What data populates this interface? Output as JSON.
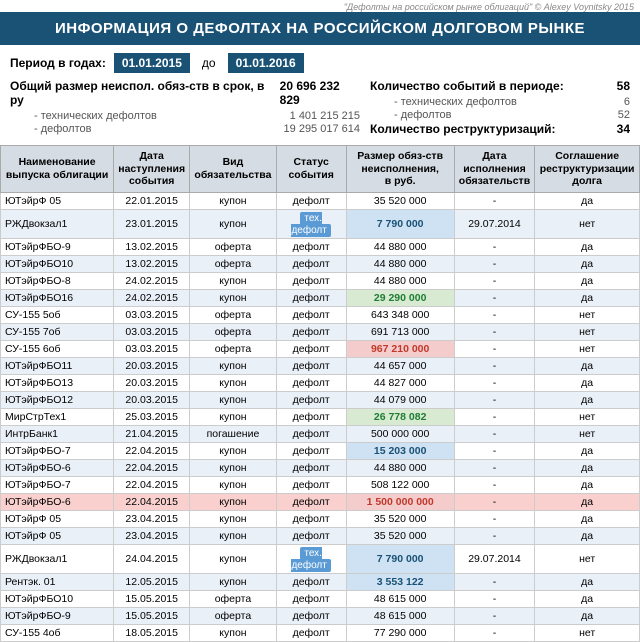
{
  "watermark": "\"Дефолты на российском рынке облигаций\" © Alexey Voynitsky 2015",
  "title": "ИНФОРМАЦИЯ О ДЕФОЛТАХ НА РОССИЙСКОМ ДОЛГОВОМ РЫНКЕ",
  "period": {
    "label": "Период в годах:",
    "from": "01.01.2015",
    "to_label": "до",
    "to": "01.01.2016"
  },
  "stats": {
    "left": {
      "main_label": "Общий размер неиспол. обяз-ств в срок, в ру",
      "main_value": "20 696 232 829",
      "sub1_label": "- технических дефолтов",
      "sub1_value": "1 401 215 215",
      "sub2_label": "- дефолтов",
      "sub2_value": "19 295 017 614"
    },
    "right": {
      "events_label": "Количество событий в периоде:",
      "events_value": "58",
      "tech_label": "- технических дефолтов",
      "tech_value": "6",
      "default_label": "- дефолтов",
      "default_value": "52",
      "restr_label": "Количество реструктуризаций:",
      "restr_value": "34"
    }
  },
  "table": {
    "headers": [
      "Наименование\nвыпуска облигации",
      "Дата\nнаступления\nсобытия",
      "Вид\nобязательства",
      "Статус\nсобытия",
      "Размер обяз-ств\nнеисполнения,\nв руб.",
      "Дата\nисполнения\nобязательств",
      "Соглашение\nреструктуризации\nдолга"
    ],
    "rows": [
      {
        "name": "ЮТэйрФ 05",
        "date": "22.01.2015",
        "type": "купон",
        "status": "дефолт",
        "amount": "35 520 000",
        "exec_date": "-",
        "agree": "да",
        "amount_class": ""
      },
      {
        "name": "РЖДвокзал1",
        "date": "23.01.2015",
        "type": "купон",
        "status": "тех. дефолт",
        "amount": "7 790 000",
        "exec_date": "29.07.2014",
        "agree": "нет",
        "amount_class": "blue"
      },
      {
        "name": "ЮТэйрФБО-9",
        "date": "13.02.2015",
        "type": "оферта",
        "status": "дефолт",
        "amount": "44 880 000",
        "exec_date": "-",
        "agree": "да",
        "amount_class": ""
      },
      {
        "name": "ЮТэйрФБО10",
        "date": "13.02.2015",
        "type": "оферта",
        "status": "дефолт",
        "amount": "44 880 000",
        "exec_date": "-",
        "agree": "да",
        "amount_class": ""
      },
      {
        "name": "ЮТэйрФБО-8",
        "date": "24.02.2015",
        "type": "купон",
        "status": "дефолт",
        "amount": "44 880 000",
        "exec_date": "-",
        "agree": "да",
        "amount_class": ""
      },
      {
        "name": "ЮТэйрФБО16",
        "date": "24.02.2015",
        "type": "купон",
        "status": "дефолт",
        "amount": "29 290 000",
        "exec_date": "-",
        "agree": "да",
        "amount_class": "green"
      },
      {
        "name": "СУ-155 5об",
        "date": "03.03.2015",
        "type": "оферта",
        "status": "дефолт",
        "amount": "643 348 000",
        "exec_date": "-",
        "agree": "нет",
        "amount_class": ""
      },
      {
        "name": "СУ-155 7об",
        "date": "03.03.2015",
        "type": "оферта",
        "status": "дефолт",
        "amount": "691 713 000",
        "exec_date": "-",
        "agree": "нет",
        "amount_class": ""
      },
      {
        "name": "СУ-155 6об",
        "date": "03.03.2015",
        "type": "оферта",
        "status": "дефолт",
        "amount": "967 210 000",
        "exec_date": "-",
        "agree": "нет",
        "amount_class": "red"
      },
      {
        "name": "ЮТэйрФБО11",
        "date": "20.03.2015",
        "type": "купон",
        "status": "дефолт",
        "amount": "44 657 000",
        "exec_date": "-",
        "agree": "да",
        "amount_class": ""
      },
      {
        "name": "ЮТэйрФБО13",
        "date": "20.03.2015",
        "type": "купон",
        "status": "дефолт",
        "amount": "44 827 000",
        "exec_date": "-",
        "agree": "да",
        "amount_class": ""
      },
      {
        "name": "ЮТэйрФБО12",
        "date": "20.03.2015",
        "type": "купон",
        "status": "дефолт",
        "amount": "44 079 000",
        "exec_date": "-",
        "agree": "да",
        "amount_class": ""
      },
      {
        "name": "МирСтрТех1",
        "date": "25.03.2015",
        "type": "купон",
        "status": "дефолт",
        "amount": "26 778 082",
        "exec_date": "-",
        "agree": "нет",
        "amount_class": "green"
      },
      {
        "name": "ИнтрБанк1",
        "date": "21.04.2015",
        "type": "погашение",
        "status": "дефолт",
        "amount": "500 000 000",
        "exec_date": "-",
        "agree": "нет",
        "amount_class": ""
      },
      {
        "name": "ЮТэйрФБО-7",
        "date": "22.04.2015",
        "type": "купон",
        "status": "дефолт",
        "amount": "15 203 000",
        "exec_date": "-",
        "agree": "да",
        "amount_class": "blue"
      },
      {
        "name": "ЮТэйрФБО-6",
        "date": "22.04.2015",
        "type": "купон",
        "status": "дефолт",
        "amount": "44 880 000",
        "exec_date": "-",
        "agree": "да",
        "amount_class": ""
      },
      {
        "name": "ЮТэйрФБО-7",
        "date": "22.04.2015",
        "type": "купон",
        "status": "дефолт",
        "amount": "508 122 000",
        "exec_date": "-",
        "agree": "да",
        "amount_class": ""
      },
      {
        "name": "ЮТэйрФБО-6",
        "date": "22.04.2015",
        "type": "купон",
        "status": "дефолт",
        "amount": "1 500 000 000",
        "exec_date": "-",
        "agree": "да",
        "amount_class": "red",
        "row_class": "row-highlight-pink"
      },
      {
        "name": "ЮТэйрФ 05",
        "date": "23.04.2015",
        "type": "купон",
        "status": "дефолт",
        "amount": "35 520 000",
        "exec_date": "-",
        "agree": "да",
        "amount_class": ""
      },
      {
        "name": "ЮТэйрФ 05",
        "date": "23.04.2015",
        "type": "купон",
        "status": "дефолт",
        "amount": "35 520 000",
        "exec_date": "-",
        "agree": "да",
        "amount_class": ""
      },
      {
        "name": "РЖДвокзал1",
        "date": "24.04.2015",
        "type": "купон",
        "status": "тех. дефолт",
        "amount": "7 790 000",
        "exec_date": "29.07.2014",
        "agree": "нет",
        "amount_class": "blue"
      },
      {
        "name": "Рентэк. 01",
        "date": "12.05.2015",
        "type": "купон",
        "status": "дефолт",
        "amount": "3 553 122",
        "exec_date": "-",
        "agree": "да",
        "amount_class": "blue"
      },
      {
        "name": "ЮТэйрФБО10",
        "date": "15.05.2015",
        "type": "оферта",
        "status": "дефолт",
        "amount": "48 615 000",
        "exec_date": "-",
        "agree": "да",
        "amount_class": ""
      },
      {
        "name": "ЮТэйрФБО-9",
        "date": "15.05.2015",
        "type": "оферта",
        "status": "дефолт",
        "amount": "48 615 000",
        "exec_date": "-",
        "agree": "да",
        "amount_class": ""
      },
      {
        "name": "СУ-155 4об",
        "date": "18.05.2015",
        "type": "купон",
        "status": "дефолт",
        "amount": "77 290 000",
        "exec_date": "-",
        "agree": "нет",
        "amount_class": ""
      }
    ]
  }
}
